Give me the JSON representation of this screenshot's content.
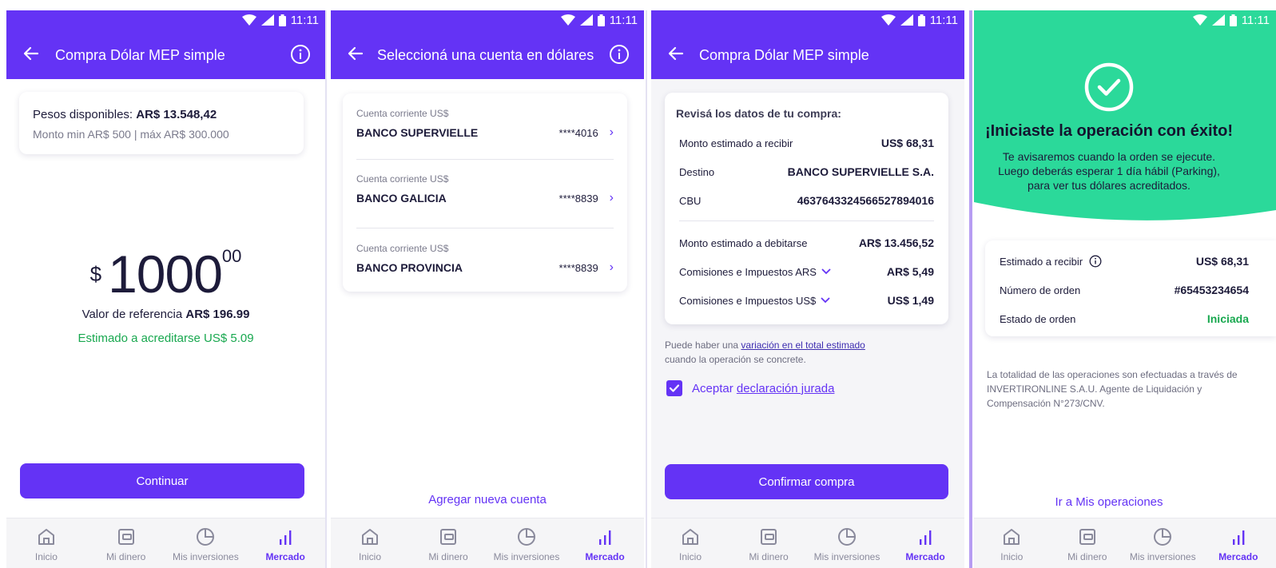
{
  "status": {
    "time": "11:11"
  },
  "colors": {
    "primary": "#6433f5",
    "success": "#2bd99a",
    "green_text": "#18a84f"
  },
  "nav": [
    {
      "label": "Inicio",
      "icon": "home-icon"
    },
    {
      "label": "Mi dinero",
      "icon": "wallet-icon"
    },
    {
      "label": "Mis inversiones",
      "icon": "pie-chart-icon"
    },
    {
      "label": "Mercado",
      "icon": "bar-chart-icon"
    }
  ],
  "s1": {
    "title": "Compra Dólar MEP simple",
    "available_label": "Pesos disponibles: ",
    "available_value": "AR$ 13.548,42",
    "limits": "Monto min AR$ 500 | máx AR$ 300.000",
    "currency": "$",
    "amount_int": "1000",
    "amount_dec": "00",
    "ref_label": "Valor de referencia ",
    "ref_value": "AR$ 196.99",
    "estimate": "Estimado a acreditarse US$ 5.09",
    "continue": "Continuar"
  },
  "s2": {
    "title": "Seleccioná una cuenta en dólares",
    "accounts": [
      {
        "type": "Cuenta corriente US$",
        "bank": "BANCO SUPERVIELLE",
        "number": "****4016"
      },
      {
        "type": "Cuenta corriente US$",
        "bank": "BANCO GALICIA",
        "number": "****8839"
      },
      {
        "type": "Cuenta corriente US$",
        "bank": "BANCO PROVINCIA",
        "number": "****8839"
      }
    ],
    "add_account": "Agregar nueva cuenta"
  },
  "s3": {
    "title": "Compra Dólar MEP simple",
    "review_heading": "Revisá los datos de tu compra:",
    "rows": [
      {
        "label": "Monto estimado a recibir",
        "value": "US$ 68,31"
      },
      {
        "label": "Destino",
        "value": "BANCO SUPERVIELLE S.A."
      },
      {
        "label": "CBU",
        "value": "4637643324566527894016"
      },
      {
        "label": "Monto estimado a debitarse",
        "value": "AR$ 13.456,52"
      },
      {
        "label": "Comisiones e Impuestos ARS",
        "value": "AR$ 5,49"
      },
      {
        "label": "Comisiones e Impuestos US$",
        "value": "US$ 1,49"
      }
    ],
    "note_prefix": "Puede haber una ",
    "note_link": "variación en el total estimado",
    "note_suffix": "cuando la operación se concrete.",
    "accept_prefix": "Aceptar ",
    "accept_link": "declaración jurada",
    "confirm": "Confirmar compra"
  },
  "s4": {
    "success_title": "¡Iniciaste la operación con éxito!",
    "success_line1": "Te avisaremos cuando la orden se ejecute.",
    "success_line2": "Luego deberás esperar 1 día hábil (Parking),",
    "success_line3": "para ver tus dólares acreditados.",
    "rows": [
      {
        "label": "Estimado a recibir",
        "value": "US$ 68,31"
      },
      {
        "label": "Número de orden",
        "value": "#65453234654"
      },
      {
        "label": "Estado de orden",
        "value": "Iniciada"
      }
    ],
    "disclaimer": "La totalidad de las operaciones son efectuadas a través de INVERTIRONLINE S.A.U. Agente de Liquidación y Compensación N°273/CNV.",
    "go_ops": "Ir a Mis operaciones"
  }
}
